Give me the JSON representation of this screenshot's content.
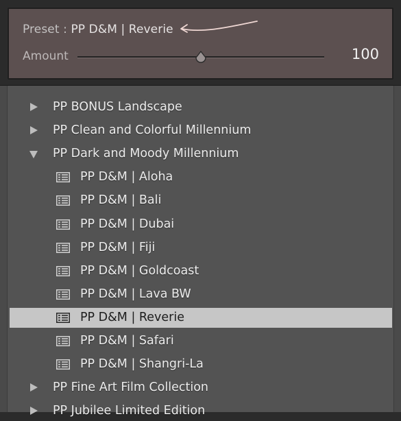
{
  "preset_panel": {
    "preset_prefix": "Preset : ",
    "preset_name": "PP D&M | Reverie",
    "amount_label": "Amount",
    "amount_value": "100",
    "amount_fraction": 0.5
  },
  "tree": {
    "items": [
      {
        "type": "folder",
        "label": "PP BONUS Landscape",
        "expanded": false
      },
      {
        "type": "folder",
        "label": "PP Clean and Colorful Millennium",
        "expanded": false
      },
      {
        "type": "folder",
        "label": "PP Dark and Moody Millennium",
        "expanded": true
      },
      {
        "type": "preset",
        "label": "PP D&M | Aloha",
        "selected": false
      },
      {
        "type": "preset",
        "label": "PP D&M | Bali",
        "selected": false
      },
      {
        "type": "preset",
        "label": "PP D&M | Dubai",
        "selected": false
      },
      {
        "type": "preset",
        "label": "PP D&M | Fiji",
        "selected": false
      },
      {
        "type": "preset",
        "label": "PP D&M | Goldcoast",
        "selected": false
      },
      {
        "type": "preset",
        "label": "PP D&M | Lava BW",
        "selected": false
      },
      {
        "type": "preset",
        "label": "PP D&M | Reverie",
        "selected": true
      },
      {
        "type": "preset",
        "label": "PP D&M | Safari",
        "selected": false
      },
      {
        "type": "preset",
        "label": "PP D&M | Shangri-La",
        "selected": false
      },
      {
        "type": "folder",
        "label": "PP Fine Art Film Collection",
        "expanded": false
      },
      {
        "type": "folder",
        "label": "PP Jubilee Limited Edition",
        "expanded": false
      }
    ]
  },
  "colors": {
    "panel_bg": "#5c5050",
    "list_bg": "#535353",
    "selected_row": "#c6c6c6",
    "annotation_arrow": "#f0d8d4"
  },
  "icons": {
    "folder_collapsed": "triangle-right-icon",
    "folder_expanded": "triangle-down-icon",
    "preset": "preset-list-icon",
    "annotation": "curved-arrow-icon"
  }
}
